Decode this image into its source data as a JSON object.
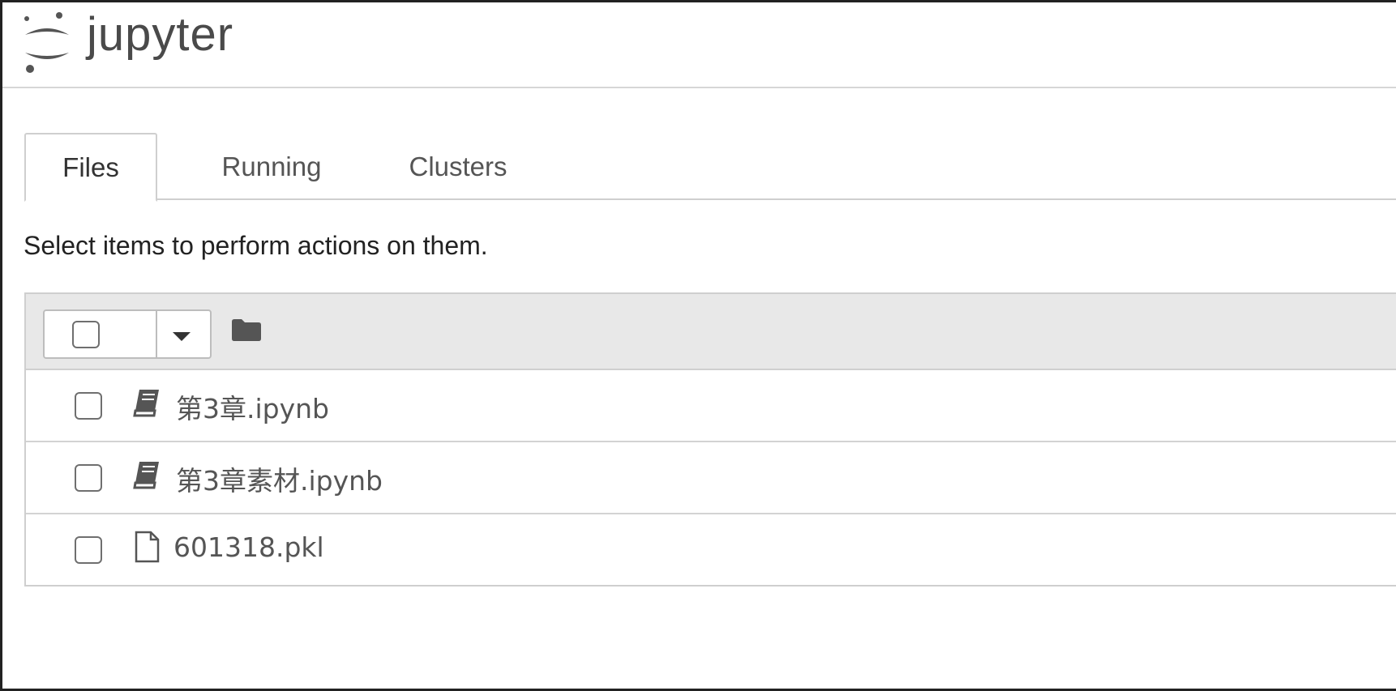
{
  "header": {
    "app_title": "jupyter"
  },
  "tabs": [
    {
      "label": "Files",
      "active": true
    },
    {
      "label": "Running",
      "active": false
    },
    {
      "label": "Clusters",
      "active": false
    }
  ],
  "instructions": "Select items to perform actions on them.",
  "toolbar": {
    "select_all_checked": false,
    "dropdown_icon": "caret-down-icon",
    "breadcrumb_icon": "folder-icon"
  },
  "files": [
    {
      "name": "第3章.ipynb",
      "icon": "notebook-icon",
      "checked": false
    },
    {
      "name": "第3章素材.ipynb",
      "icon": "notebook-icon",
      "checked": false
    },
    {
      "name": "601318.pkl",
      "icon": "file-icon",
      "checked": false
    }
  ],
  "colors": {
    "toolbar_bg": "#e8e8e8",
    "border": "#cfcfcf",
    "text": "#555555"
  }
}
